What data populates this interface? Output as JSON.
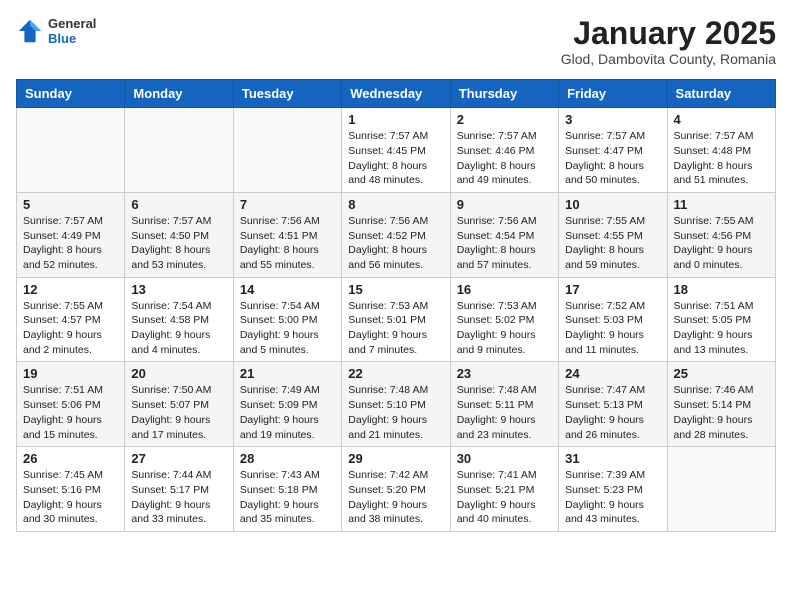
{
  "header": {
    "logo_general": "General",
    "logo_blue": "Blue",
    "month_title": "January 2025",
    "location": "Glod, Dambovita County, Romania"
  },
  "weekdays": [
    "Sunday",
    "Monday",
    "Tuesday",
    "Wednesday",
    "Thursday",
    "Friday",
    "Saturday"
  ],
  "weeks": [
    [
      {
        "day": "",
        "info": ""
      },
      {
        "day": "",
        "info": ""
      },
      {
        "day": "",
        "info": ""
      },
      {
        "day": "1",
        "info": "Sunrise: 7:57 AM\nSunset: 4:45 PM\nDaylight: 8 hours\nand 48 minutes."
      },
      {
        "day": "2",
        "info": "Sunrise: 7:57 AM\nSunset: 4:46 PM\nDaylight: 8 hours\nand 49 minutes."
      },
      {
        "day": "3",
        "info": "Sunrise: 7:57 AM\nSunset: 4:47 PM\nDaylight: 8 hours\nand 50 minutes."
      },
      {
        "day": "4",
        "info": "Sunrise: 7:57 AM\nSunset: 4:48 PM\nDaylight: 8 hours\nand 51 minutes."
      }
    ],
    [
      {
        "day": "5",
        "info": "Sunrise: 7:57 AM\nSunset: 4:49 PM\nDaylight: 8 hours\nand 52 minutes."
      },
      {
        "day": "6",
        "info": "Sunrise: 7:57 AM\nSunset: 4:50 PM\nDaylight: 8 hours\nand 53 minutes."
      },
      {
        "day": "7",
        "info": "Sunrise: 7:56 AM\nSunset: 4:51 PM\nDaylight: 8 hours\nand 55 minutes."
      },
      {
        "day": "8",
        "info": "Sunrise: 7:56 AM\nSunset: 4:52 PM\nDaylight: 8 hours\nand 56 minutes."
      },
      {
        "day": "9",
        "info": "Sunrise: 7:56 AM\nSunset: 4:54 PM\nDaylight: 8 hours\nand 57 minutes."
      },
      {
        "day": "10",
        "info": "Sunrise: 7:55 AM\nSunset: 4:55 PM\nDaylight: 8 hours\nand 59 minutes."
      },
      {
        "day": "11",
        "info": "Sunrise: 7:55 AM\nSunset: 4:56 PM\nDaylight: 9 hours\nand 0 minutes."
      }
    ],
    [
      {
        "day": "12",
        "info": "Sunrise: 7:55 AM\nSunset: 4:57 PM\nDaylight: 9 hours\nand 2 minutes."
      },
      {
        "day": "13",
        "info": "Sunrise: 7:54 AM\nSunset: 4:58 PM\nDaylight: 9 hours\nand 4 minutes."
      },
      {
        "day": "14",
        "info": "Sunrise: 7:54 AM\nSunset: 5:00 PM\nDaylight: 9 hours\nand 5 minutes."
      },
      {
        "day": "15",
        "info": "Sunrise: 7:53 AM\nSunset: 5:01 PM\nDaylight: 9 hours\nand 7 minutes."
      },
      {
        "day": "16",
        "info": "Sunrise: 7:53 AM\nSunset: 5:02 PM\nDaylight: 9 hours\nand 9 minutes."
      },
      {
        "day": "17",
        "info": "Sunrise: 7:52 AM\nSunset: 5:03 PM\nDaylight: 9 hours\nand 11 minutes."
      },
      {
        "day": "18",
        "info": "Sunrise: 7:51 AM\nSunset: 5:05 PM\nDaylight: 9 hours\nand 13 minutes."
      }
    ],
    [
      {
        "day": "19",
        "info": "Sunrise: 7:51 AM\nSunset: 5:06 PM\nDaylight: 9 hours\nand 15 minutes."
      },
      {
        "day": "20",
        "info": "Sunrise: 7:50 AM\nSunset: 5:07 PM\nDaylight: 9 hours\nand 17 minutes."
      },
      {
        "day": "21",
        "info": "Sunrise: 7:49 AM\nSunset: 5:09 PM\nDaylight: 9 hours\nand 19 minutes."
      },
      {
        "day": "22",
        "info": "Sunrise: 7:48 AM\nSunset: 5:10 PM\nDaylight: 9 hours\nand 21 minutes."
      },
      {
        "day": "23",
        "info": "Sunrise: 7:48 AM\nSunset: 5:11 PM\nDaylight: 9 hours\nand 23 minutes."
      },
      {
        "day": "24",
        "info": "Sunrise: 7:47 AM\nSunset: 5:13 PM\nDaylight: 9 hours\nand 26 minutes."
      },
      {
        "day": "25",
        "info": "Sunrise: 7:46 AM\nSunset: 5:14 PM\nDaylight: 9 hours\nand 28 minutes."
      }
    ],
    [
      {
        "day": "26",
        "info": "Sunrise: 7:45 AM\nSunset: 5:16 PM\nDaylight: 9 hours\nand 30 minutes."
      },
      {
        "day": "27",
        "info": "Sunrise: 7:44 AM\nSunset: 5:17 PM\nDaylight: 9 hours\nand 33 minutes."
      },
      {
        "day": "28",
        "info": "Sunrise: 7:43 AM\nSunset: 5:18 PM\nDaylight: 9 hours\nand 35 minutes."
      },
      {
        "day": "29",
        "info": "Sunrise: 7:42 AM\nSunset: 5:20 PM\nDaylight: 9 hours\nand 38 minutes."
      },
      {
        "day": "30",
        "info": "Sunrise: 7:41 AM\nSunset: 5:21 PM\nDaylight: 9 hours\nand 40 minutes."
      },
      {
        "day": "31",
        "info": "Sunrise: 7:39 AM\nSunset: 5:23 PM\nDaylight: 9 hours\nand 43 minutes."
      },
      {
        "day": "",
        "info": ""
      }
    ]
  ]
}
